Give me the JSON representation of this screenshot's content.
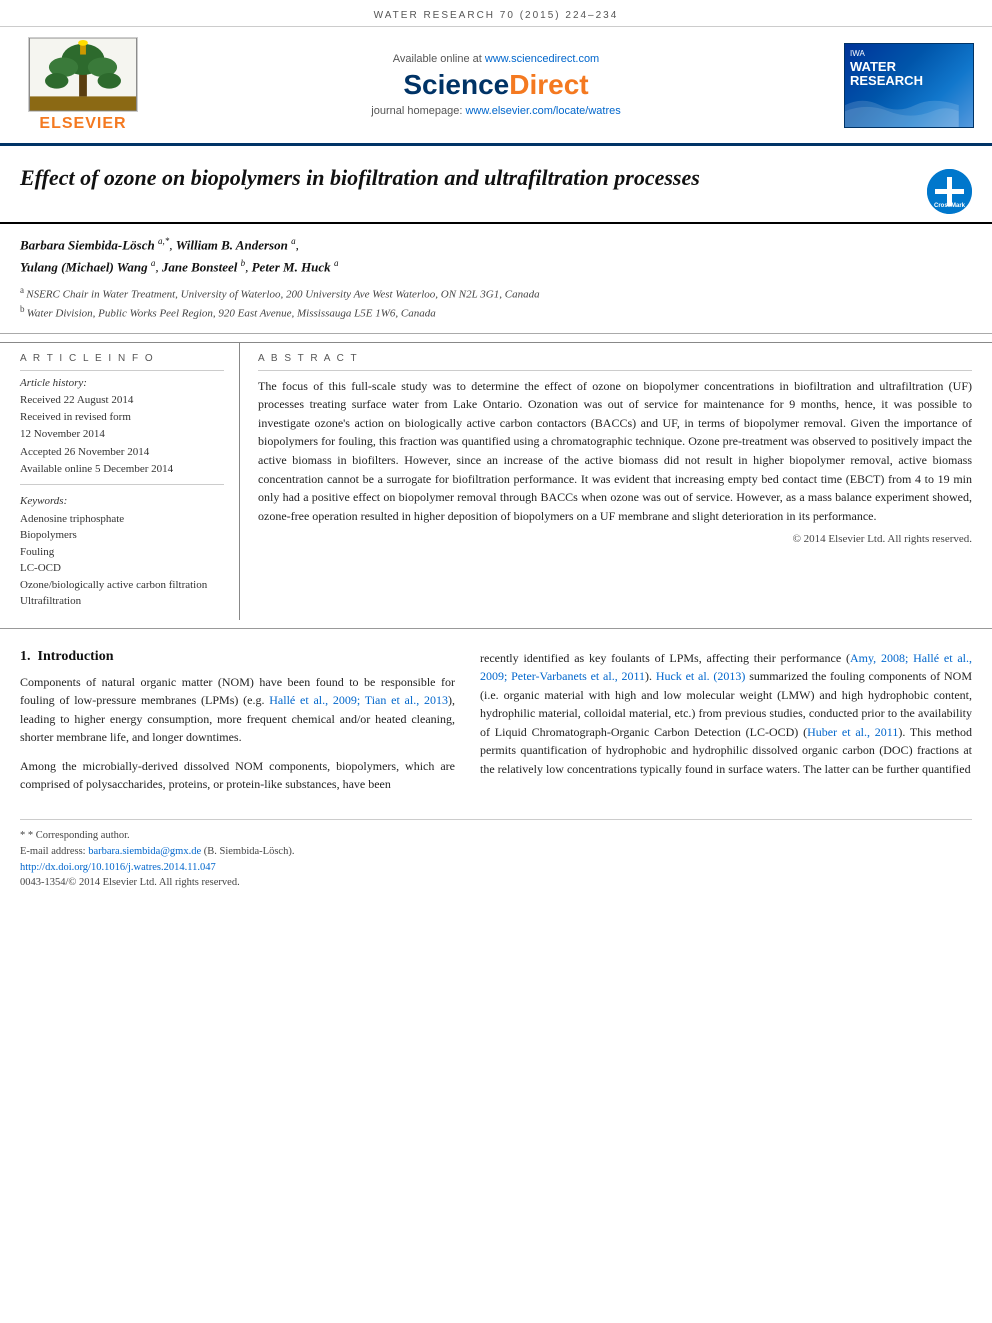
{
  "journal_header": {
    "title": "WATER RESEARCH 70 (2015) 224–234"
  },
  "publisher_band": {
    "available_online_label": "Available online at",
    "available_online_url": "www.sciencedirect.com",
    "sciencedirect_label": "ScienceDirect",
    "journal_homepage_label": "journal homepage:",
    "journal_homepage_url": "www.elsevier.com/locate/watres",
    "elsevier_label": "ELSEVIER",
    "water_research_label": "WATER\nRESEARCH"
  },
  "article": {
    "title": "Effect of ozone on biopolymers in biofiltration and ultrafiltration processes",
    "crossmark_label": "Cross\nMark"
  },
  "authors": {
    "line1": "Barbara Siembida-Lösch a,*, William B. Anderson a,",
    "line2": "Yulang (Michael) Wang a, Jane Bonsteel b, Peter M. Huck a",
    "affiliations": [
      {
        "sup": "a",
        "text": "NSERC Chair in Water Treatment, University of Waterloo, 200 University Ave West Waterloo, ON N2L 3G1, Canada"
      },
      {
        "sup": "b",
        "text": "Water Division, Public Works Peel Region, 920 East Avenue, Mississauga L5E 1W6, Canada"
      }
    ]
  },
  "article_info": {
    "section_label": "A R T I C L E   I N F O",
    "history_label": "Article history:",
    "history": [
      "Received 22 August 2014",
      "Received in revised form",
      "12 November 2014",
      "Accepted 26 November 2014",
      "Available online 5 December 2014"
    ],
    "keywords_label": "Keywords:",
    "keywords": [
      "Adenosine triphosphate",
      "Biopolymers",
      "Fouling",
      "LC-OCD",
      "Ozone/biologically active carbon filtration",
      "Ultrafiltration"
    ]
  },
  "abstract": {
    "section_label": "A B S T R A C T",
    "text": "The focus of this full-scale study was to determine the effect of ozone on biopolymer concentrations in biofiltration and ultrafiltration (UF) processes treating surface water from Lake Ontario. Ozonation was out of service for maintenance for 9 months, hence, it was possible to investigate ozone's action on biologically active carbon contactors (BACCs) and UF, in terms of biopolymer removal. Given the importance of biopolymers for fouling, this fraction was quantified using a chromatographic technique. Ozone pre-treatment was observed to positively impact the active biomass in biofilters. However, since an increase of the active biomass did not result in higher biopolymer removal, active biomass concentration cannot be a surrogate for biofiltration performance. It was evident that increasing empty bed contact time (EBCT) from 4 to 19 min only had a positive effect on biopolymer removal through BACCs when ozone was out of service. However, as a mass balance experiment showed, ozone-free operation resulted in higher deposition of biopolymers on a UF membrane and slight deterioration in its performance.",
    "copyright": "© 2014 Elsevier Ltd. All rights reserved."
  },
  "introduction": {
    "number": "1.",
    "heading": "Introduction",
    "para1": "Components of natural organic matter (NOM) have been found to be responsible for fouling of low-pressure membranes (LPMs) (e.g. Hallé et al., 2009; Tian et al., 2013), leading to higher energy consumption, more frequent chemical and/or heated cleaning, shorter membrane life, and longer downtimes.",
    "para2": "Among the microbially-derived dissolved NOM components, biopolymers, which are comprised of polysaccharides, proteins, or protein-like substances, have been",
    "para3": "recently identified as key foulants of LPMs, affecting their performance (Amy, 2008; Hallé et al., 2009; Peter-Varbanets et al., 2011). Huck et al. (2013) summarized the fouling components of NOM (i.e. organic material with high and low molecular weight (LMW) and high hydrophobic content, hydrophilic material, colloidal material, etc.) from previous studies, conducted prior to the availability of Liquid Chromatograph-Organic Carbon Detection (LC-OCD) (Huber et al., 2011). This method permits quantification of hydrophobic and hydrophilic dissolved organic carbon (DOC) fractions at the relatively low concentrations typically found in surface waters. The latter can be further quantified"
  },
  "footnotes": {
    "corresponding_label": "* Corresponding author.",
    "email_label": "E-mail address:",
    "email": "barbara.siembida@gmx.de",
    "email_author": "(B. Siembida-Lösch).",
    "doi": "http://dx.doi.org/10.1016/j.watres.2014.11.047",
    "issn": "0043-1354/© 2014 Elsevier Ltd. All rights reserved."
  }
}
